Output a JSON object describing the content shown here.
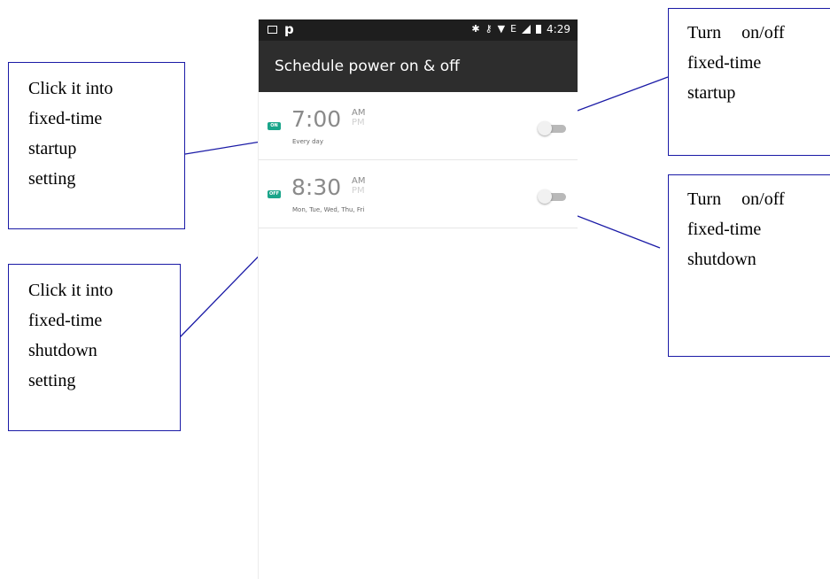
{
  "status_bar": {
    "left_icons": [
      "image-icon",
      "p-icon"
    ],
    "p_label": "p",
    "right_glyphs": [
      "bluetooth-icon",
      "key-icon",
      "wifi-icon"
    ],
    "network_label": "E",
    "time": "4:29"
  },
  "app_bar": {
    "title": "Schedule power on & off"
  },
  "schedules": [
    {
      "badge": "ON",
      "time": "7:00",
      "am": "AM",
      "pm": "PM",
      "repeat": "Every day",
      "enabled": false
    },
    {
      "badge": "OFF",
      "time": "8:30",
      "am": "AM",
      "pm": "PM",
      "repeat": "Mon, Tue, Wed, Thu, Fri",
      "enabled": false
    }
  ],
  "callouts": {
    "startup_setting": [
      "Click it into",
      "fixed-time",
      "startup",
      "setting"
    ],
    "shutdown_setting": [
      "Click it into",
      "fixed-time",
      "shutdown",
      "setting"
    ],
    "toggle_startup": [
      "Turn on/off",
      "fixed-time",
      "startup"
    ],
    "toggle_shutdown": [
      "Turn on/off",
      "fixed-time",
      "shutdown"
    ]
  },
  "colors": {
    "accent_green": "#1aa58a",
    "callout_border": "#1a1aa6",
    "app_bar": "#2d2d2d"
  }
}
